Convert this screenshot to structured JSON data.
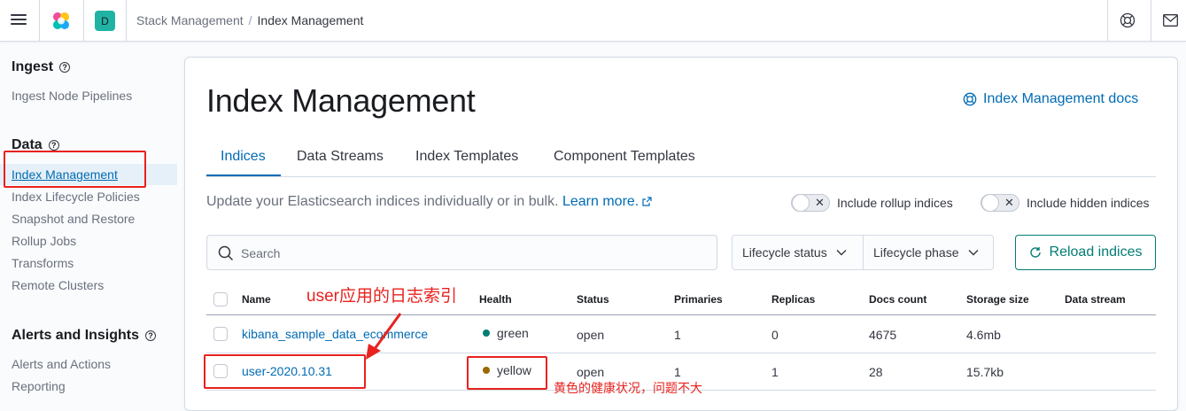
{
  "header": {
    "space_initial": "D",
    "breadcrumb": {
      "parent": "Stack Management",
      "separator": "/",
      "current": "Index Management"
    }
  },
  "sidebar": {
    "sections": [
      {
        "title": "Ingest",
        "items": [
          "Ingest Node Pipelines"
        ]
      },
      {
        "title": "Data",
        "items": [
          "Index Management",
          "Index Lifecycle Policies",
          "Snapshot and Restore",
          "Rollup Jobs",
          "Transforms",
          "Remote Clusters"
        ]
      },
      {
        "title": "Alerts and Insights",
        "items": [
          "Alerts and Actions",
          "Reporting"
        ]
      }
    ],
    "active_item": "Index Management"
  },
  "main": {
    "title": "Index Management",
    "docs_link": "Index Management docs",
    "tabs": [
      "Indices",
      "Data Streams",
      "Index Templates",
      "Component Templates"
    ],
    "active_tab": "Indices",
    "description": "Update your Elasticsearch indices individually or in bulk.",
    "learn_more": "Learn more.",
    "toggles": [
      "Include rollup indices",
      "Include hidden indices"
    ],
    "search_placeholder": "Search",
    "filters": [
      "Lifecycle status",
      "Lifecycle phase"
    ],
    "reload_label": "Reload indices"
  },
  "table": {
    "columns": [
      "Name",
      "Health",
      "Status",
      "Primaries",
      "Replicas",
      "Docs count",
      "Storage size",
      "Data stream"
    ],
    "rows": [
      {
        "name": "kibana_sample_data_ecommerce",
        "health": "green",
        "health_color": "#017d73",
        "status": "open",
        "primaries": "1",
        "replicas": "0",
        "docs_count": "4675",
        "storage_size": "4.6mb",
        "data_stream": ""
      },
      {
        "name": "user-2020.10.31",
        "health": "yellow",
        "health_color": "#9b6900",
        "status": "open",
        "primaries": "1",
        "replicas": "1",
        "docs_count": "28",
        "storage_size": "15.7kb",
        "data_stream": ""
      }
    ]
  },
  "annotations": {
    "index_note": "user应用的日志索引",
    "health_note": "黄色的健康状况，问题不大",
    "color": "#e8221e"
  },
  "colors": {
    "accent": "#006bb4",
    "success": "#017d73"
  }
}
